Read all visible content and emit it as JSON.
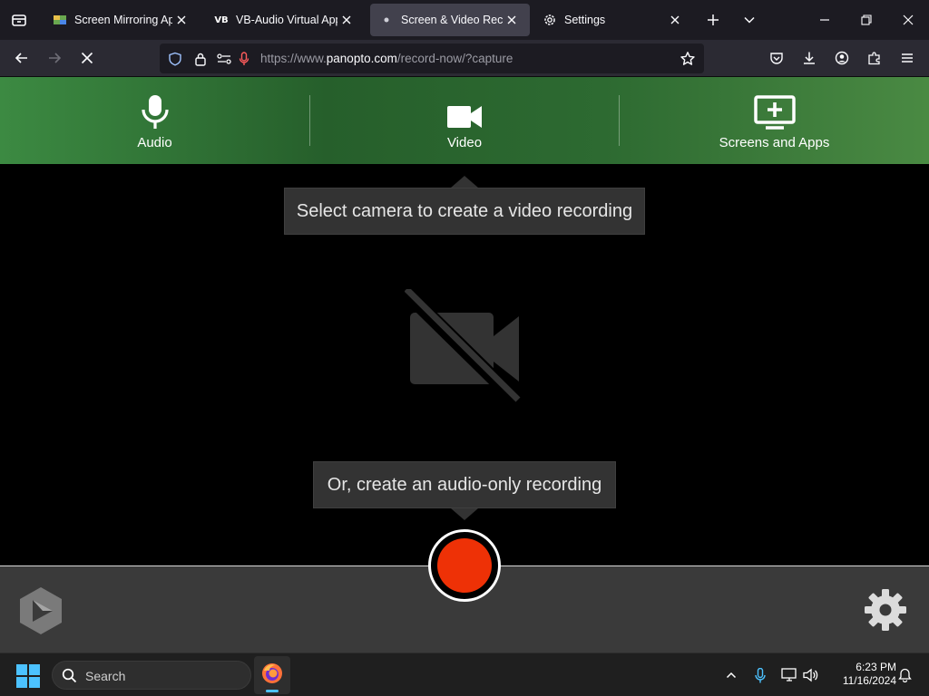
{
  "browser": {
    "tabs": [
      {
        "title": "Screen Mirroring App",
        "favicon": "screen-mirroring-favicon",
        "active": false
      },
      {
        "title": "VB-Audio Virtual Apps",
        "favicon": "vb-audio-favicon",
        "active": false
      },
      {
        "title": "Screen & Video Recorde",
        "favicon": "loading-dot",
        "active": true
      },
      {
        "title": "Settings",
        "favicon": "gear-icon",
        "active": false
      }
    ],
    "url": {
      "scheme": "https://www.",
      "host": "panopto.com",
      "path": "/record-now/?capture"
    }
  },
  "app": {
    "modes": [
      {
        "label": "Audio",
        "icon": "microphone-icon"
      },
      {
        "label": "Video",
        "icon": "video-camera-icon"
      },
      {
        "label": "Screens and Apps",
        "icon": "screen-add-icon"
      }
    ],
    "camera_tooltip": "Select camera to create a video recording",
    "audio_tooltip": "Or, create an audio-only recording",
    "placeholder_icon": "video-camera-off-icon",
    "record_color": "#ee3106",
    "header_color": "#2d6a31"
  },
  "taskbar": {
    "search_placeholder": "Search",
    "time": "6:23 PM",
    "date": "11/16/2024"
  }
}
